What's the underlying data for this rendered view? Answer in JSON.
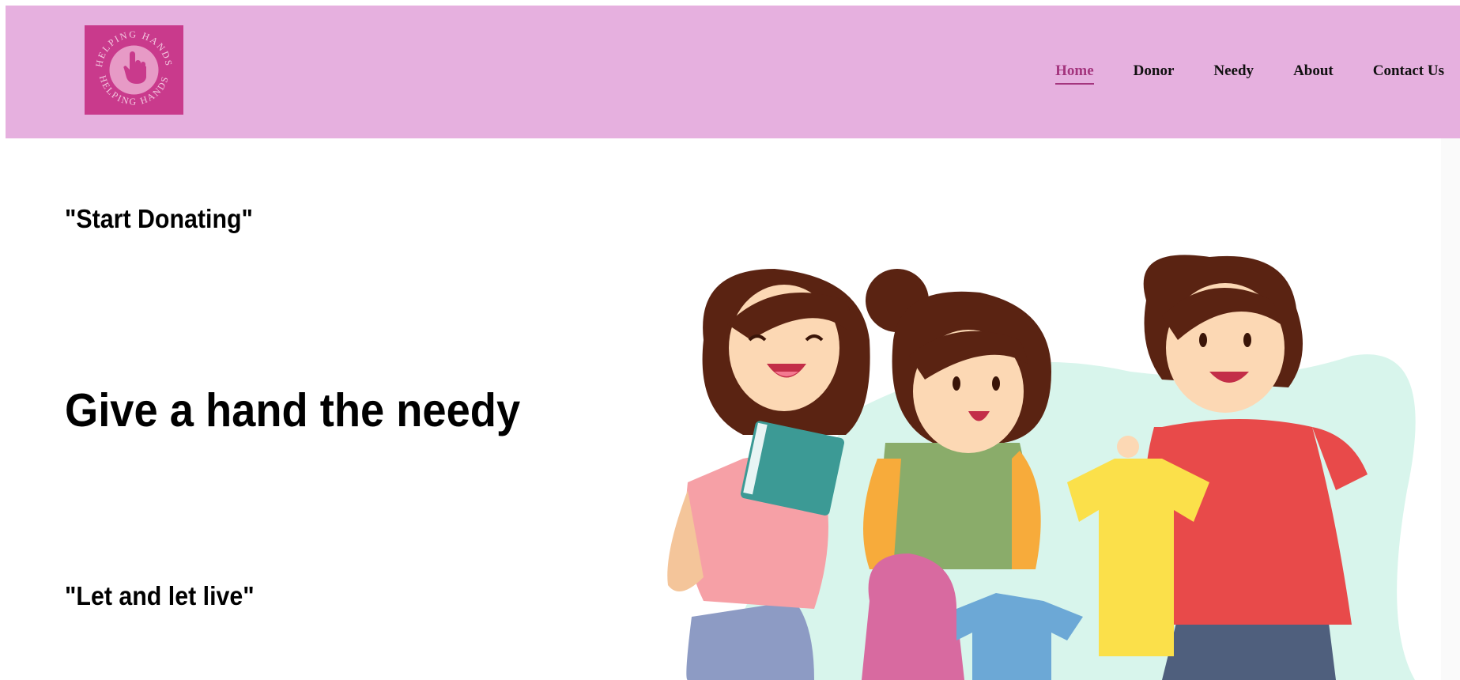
{
  "header": {
    "logo": {
      "text_top": "HELPING HANDS",
      "text_bottom": "HELPING HANDS",
      "icon": "pointing-hand-icon"
    },
    "nav": [
      {
        "label": "Home",
        "active": true
      },
      {
        "label": "Donor",
        "active": false
      },
      {
        "label": "Needy",
        "active": false
      },
      {
        "label": "About",
        "active": false
      },
      {
        "label": "Contact Us",
        "active": false
      }
    ]
  },
  "hero": {
    "tagline_top": "\"Start Donating\"",
    "headline": "Give a hand the needy",
    "tagline_bottom": "\"Let and let live\"",
    "illustration": "three-people-sorting-clothes-donations"
  },
  "colors": {
    "header_bg": "#e6b0df",
    "logo_bg": "#c93a8c",
    "active_nav": "#a4357e"
  }
}
